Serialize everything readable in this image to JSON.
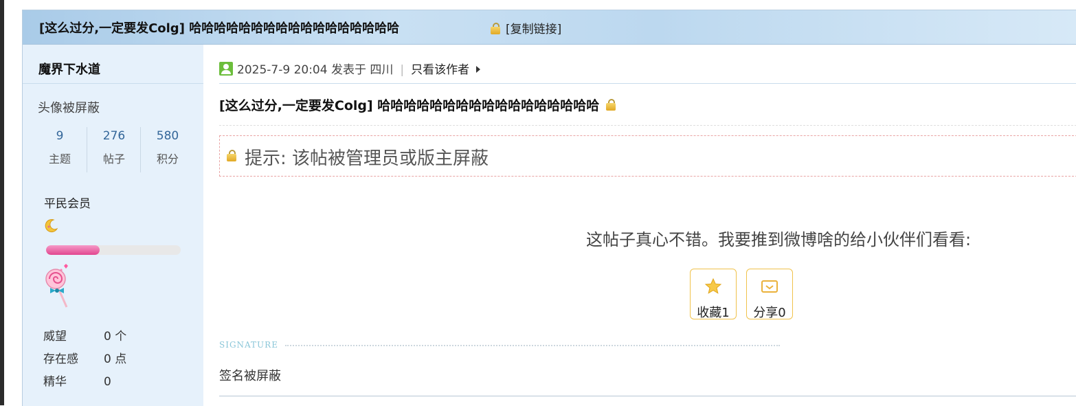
{
  "thread": {
    "title": "[这么过分,一定要发Colg] 哈哈哈哈哈哈哈哈哈哈哈哈哈哈哈哈哈",
    "copy_link": "[复制链接]"
  },
  "user": {
    "name": "魔界下水道",
    "avatar_text": "头像被屏蔽",
    "stats": [
      {
        "value": "9",
        "label": "主题"
      },
      {
        "value": "276",
        "label": "帖子"
      },
      {
        "value": "580",
        "label": "积分"
      }
    ],
    "rank": "平民会员",
    "level_progress": 0.4,
    "info": [
      {
        "key": "威望",
        "value": "0 个"
      },
      {
        "key": "存在感",
        "value": "0 点"
      },
      {
        "key": "精华",
        "value": "0"
      }
    ]
  },
  "post": {
    "meta": "2025-7-9 20:04 发表于 四川",
    "separator": "|",
    "author_only": "只看该作者",
    "title": "[这么过分,一定要发Colg] 哈哈哈哈哈哈哈哈哈哈哈哈哈哈哈哈哈",
    "notice": "提示: 该帖被管理员或版主屏蔽",
    "share_prompt": "这帖子真心不错。我要推到微博啥的给小伙伴们看看:",
    "favorite_label": "收藏1",
    "share_label": "分享0",
    "signature_label": "SIGNATURE",
    "signature_text": "签名被屏蔽"
  },
  "colors": {
    "accent": "#336699",
    "title_bar": "#bcd8ef",
    "sidebar": "#e6f1fb",
    "button_border": "#f0c24b"
  }
}
